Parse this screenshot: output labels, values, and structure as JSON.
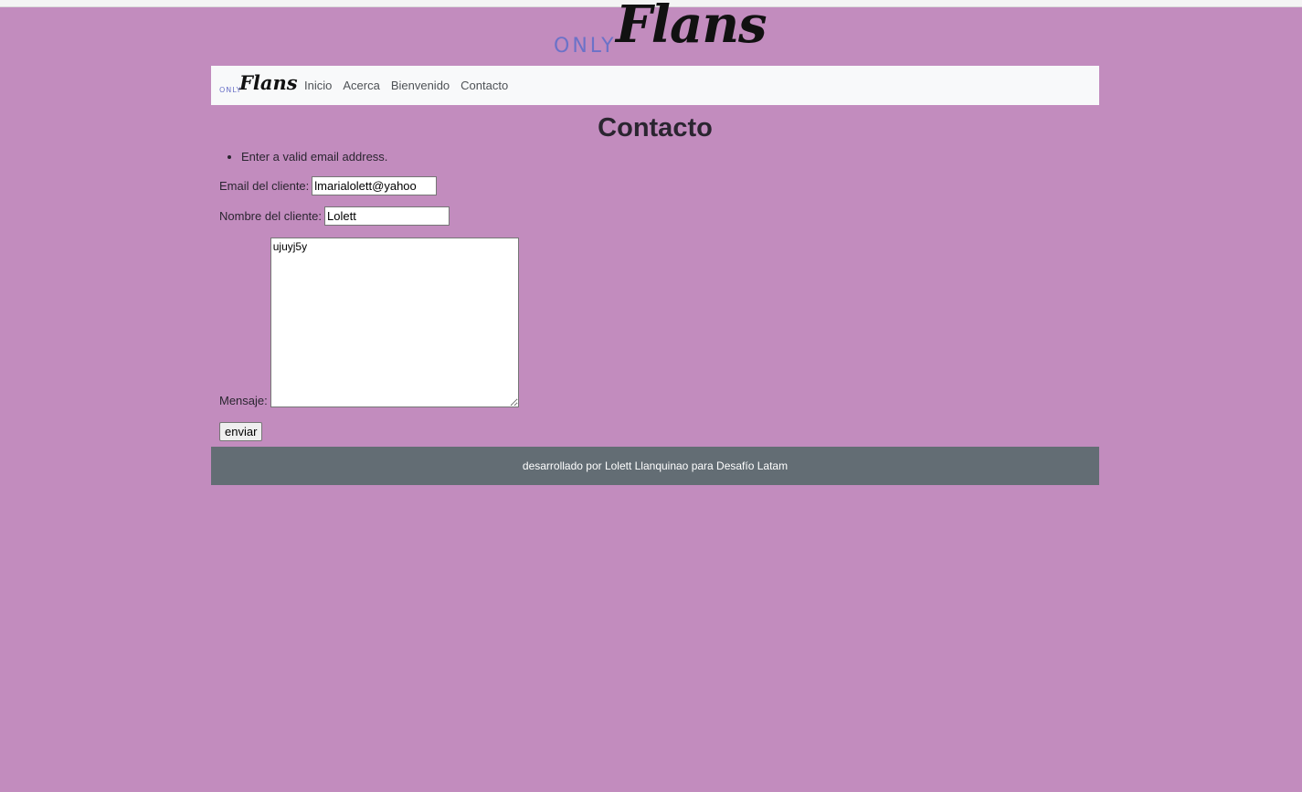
{
  "brand": {
    "hero_only": "ONLY",
    "hero_flans": "Flans",
    "nav_only": "ONLY",
    "nav_flans": "Flans"
  },
  "nav": {
    "items": [
      {
        "label": "Inicio"
      },
      {
        "label": "Acerca"
      },
      {
        "label": "Bienvenido"
      },
      {
        "label": "Contacto"
      }
    ]
  },
  "page": {
    "title": "Contacto"
  },
  "form": {
    "errors": [
      "Enter a valid email address."
    ],
    "email_label": "Email del cliente:",
    "email_value": "lmarialolett@yahoo",
    "name_label": "Nombre del cliente:",
    "name_value": "Lolett",
    "message_label": "Mensaje:",
    "message_value": "ujuyj5y",
    "submit_label": "enviar"
  },
  "footer": {
    "text": "desarrollado por Lolett Llanquinao para Desafío Latam"
  },
  "colors": {
    "background": "#c28cbe",
    "navbar": "#f8f9fa",
    "footer": "#636d74",
    "logo_only": "#6b72c8"
  }
}
